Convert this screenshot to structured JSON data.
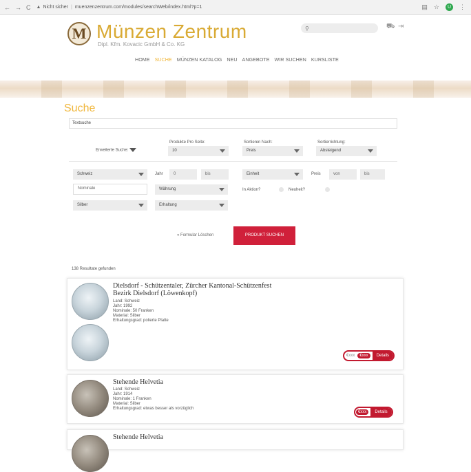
{
  "browser": {
    "security_label": "Nicht sicher",
    "url": "muenzenzentrum.com/modules/searchWeb/index.html?p=1",
    "extension_badge": "U"
  },
  "header": {
    "logo_letter": "M",
    "title": "Münzen Zentrum",
    "subtitle": "Dipl. Kfm. Kovacic GmbH & Co. KG"
  },
  "menu": {
    "items": [
      "HOME",
      "SUCHE",
      "MÜNZEN KATALOG",
      "NEU",
      "ANGEBOTE",
      "WIR SUCHEN",
      "KURSLISTE"
    ],
    "active_index": 1
  },
  "search_form": {
    "heading": "Suche",
    "text_search_placeholder": "Textsuche",
    "extended_search_label": "Erweiterte Suche:",
    "products_per_page": {
      "label": "Produkte Pro Seite:",
      "value": "10"
    },
    "sort_by": {
      "label": "Sortieren Nach:",
      "value": "Preis"
    },
    "sort_direction": {
      "label": "Sortierrichtung:",
      "value": "Absteigend"
    },
    "country": "Schweiz",
    "year_label": "Jahr",
    "year_from": "0",
    "year_to": "bis",
    "unit": "Einheit",
    "price_label": "Preis",
    "price_from": "von",
    "price_to": "bis",
    "nominal_placeholder": "Nominale",
    "currency": "Währung",
    "in_action_label": "In Aktion?",
    "new_label": "Neuheit?",
    "material": "Silber",
    "condition": "Erhaltung",
    "clear_label": "« Formular Löschen",
    "submit_label": "PRODUKT SUCHEN"
  },
  "results": {
    "count_text": "138 Resultate gefunden",
    "items": [
      {
        "title_line1": "Dielsdorf - Schützentaler, Zürcher Kantonal-Schützenfest",
        "title_line2": "Bezirk Dielsdorf (Löwenkopf)",
        "country": "Land: Schweiz",
        "year": "Jahr: 1992",
        "nominal": "Nominale: 50 Franken",
        "material": "Material: Silber",
        "condition": "Erhaltungsgrad: polierte Platte",
        "price": "€xxx",
        "price_chf": "€xxx",
        "details": "Details"
      },
      {
        "title_line1": "Stehende Helvetia",
        "country": "Land: Schweiz",
        "year": "Jahr: 1914",
        "nominal": "Nominale: 1 Franken",
        "material": "Material: Silber",
        "condition": "Erhaltungsgrad: etwas besser als vorzüglich",
        "price_chf": "€xxx",
        "details": "Details"
      },
      {
        "title_line1": "Stehende Helvetia"
      }
    ]
  },
  "colors": {
    "accent": "#f0b63a",
    "button": "#d0203a",
    "badge": "#c2192f"
  }
}
